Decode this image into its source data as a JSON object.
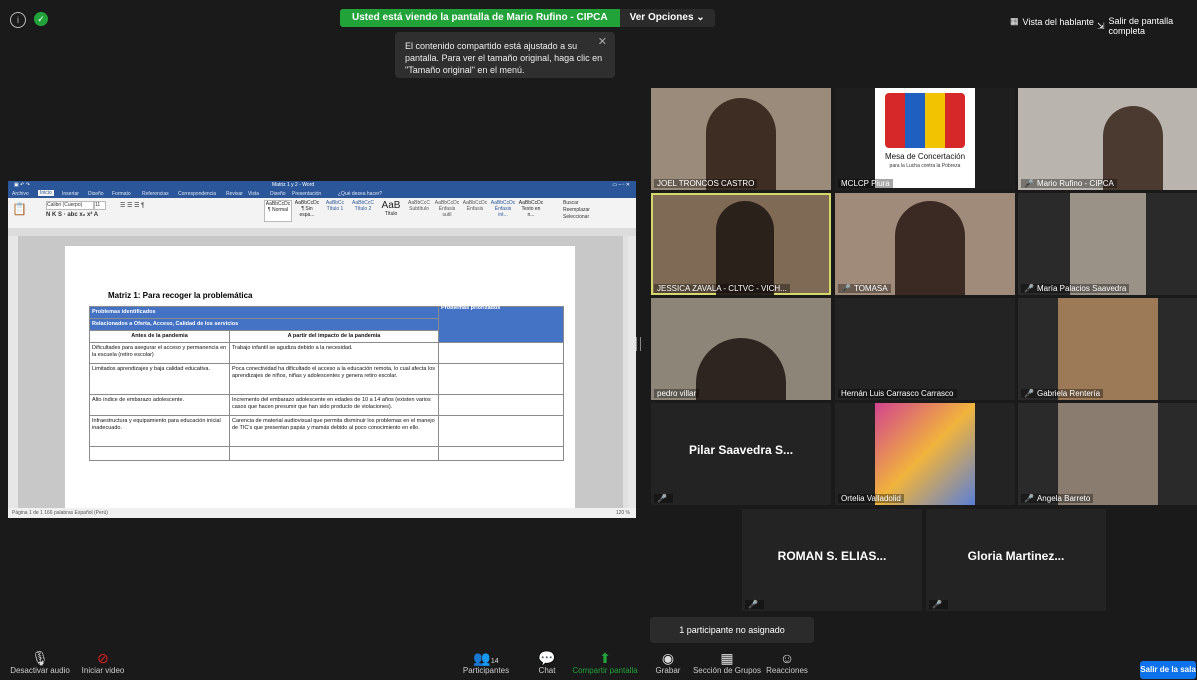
{
  "banner": {
    "viewing": "Usted está viendo la pantalla de Mario Rufino - CIPCA",
    "options": "Ver Opciones ⌄"
  },
  "tooltip": {
    "text": "El contenido compartido está ajustado a su pantalla. Para ver el tamaño original, haga clic en \"Tamaño original\" en el menú.",
    "close": "✕"
  },
  "top_right": {
    "speaker_view": "Vista del hablante",
    "exit_fullscreen": "Salir de pantalla completa"
  },
  "word": {
    "title": "Matriz 1 y 2 - Word",
    "tabs": [
      "Archivo",
      "Inicio",
      "Insertar",
      "Diseño",
      "Formato",
      "Referencias",
      "Correspondencia",
      "Revisar",
      "Vista",
      "Diseño",
      "Presentación",
      "¿Qué desea hacer?"
    ],
    "font": "Calibri (Cuerpo)",
    "font_size": "11",
    "styles": [
      "AaBbCcDc",
      "AaBbCcDc",
      "AaBbCc",
      "AaBbCcC",
      "AaB",
      "AaBbCcC",
      "AaBbCcDc",
      "AaBbCcDc",
      "AaBbCcDc",
      "AaBbCcDc"
    ],
    "style_names": [
      "¶ Normal",
      "¶ Sin espa...",
      "Título 1",
      "Título 2",
      "Título",
      "Subtítulo",
      "Énfasis sutil",
      "Énfasis",
      "Énfasis int...",
      "Texto en n..."
    ],
    "edit": [
      "Buscar",
      "Reemplazar",
      "Seleccionar"
    ],
    "status": "Página 1 de 1   166 palabras   Español (Perú)",
    "zoom": "120 %"
  },
  "doc": {
    "heading": "Matriz 1: Para recoger la problemática",
    "h1": "Problemas identificados",
    "h2": "Relacionados a Oferta, Acceso, Calidad de los servicios",
    "h_prior": "Problemas priorizados",
    "col1": "Antes de la pandemia",
    "col2": "A partir del impacto de la pandemia",
    "rows": [
      {
        "a": "Dificultades para asegurar el acceso y permanencia en la escuela (retiro escolar)",
        "b": "Trabajo infantil se agudiza debido a la necesidad."
      },
      {
        "a": "Limitados aprendizajes y baja calidad educativa.",
        "b": "Poca conectividad ha dificultado el acceso a la educación remota, lo cual afecta los aprendizajes de niños, niñas y adolescentes y genera retiro escolar."
      },
      {
        "a": "Alto índice de embarazo adolescente.",
        "b": "Incremento del embarazo adolescente en edades de 10 a 14 años (existen varios casos que hacen presumir que han sido producto de violaciones)."
      },
      {
        "a": "Infraestructura y equipamiento para educación inicial inadecuado.",
        "b": "Carencia de material audiovisual que permita disminuir los problemas en el manejo de TIC's que presentan papás y mamás debido al poco conocimiento en ello."
      },
      {
        "a": "",
        "b": ""
      }
    ]
  },
  "gallery": [
    {
      "label": "JOEL TRONCOS CASTRO",
      "muted": false,
      "bg": "#9a8b7a"
    },
    {
      "label": "MCLCP Piura",
      "muted": false,
      "bg": "#1e1e1e"
    },
    {
      "label": "Mario Rufino - CIPCA",
      "muted": true,
      "bg": "#b9b4ad"
    },
    {
      "label": "JESSICA ZAVALA - CLTVC - VICH...",
      "muted": false,
      "bg": "#7f6a55"
    },
    {
      "label": "TOMASA",
      "muted": true,
      "bg": "#a08a7a"
    },
    {
      "label": "María Palacios Saavedra",
      "muted": true,
      "bg": "#2a2a2a"
    },
    {
      "label": "pedro villar",
      "muted": false,
      "bg": "#8d8577"
    },
    {
      "label": "Hernán Luis Carrasco Carrasco",
      "muted": false,
      "bg": "#232323"
    },
    {
      "label": "Gabriela Rentería",
      "muted": true,
      "bg": "#2a2a2a"
    },
    {
      "label": "",
      "name": "Pilar Saavedra S...",
      "muted": true,
      "bg": "#232323"
    },
    {
      "label": "Ortelia Valladolid",
      "muted": false,
      "bg": "#232323"
    },
    {
      "label": "Angela Barreto",
      "muted": true,
      "bg": "#2a2a2a"
    },
    {
      "label": "",
      "name": "ROMAN S. ELIAS...",
      "muted": true,
      "bg": "#232323"
    },
    {
      "label": "",
      "name": "Gloria Martinez...",
      "muted": true,
      "bg": "#232323"
    }
  ],
  "logo": {
    "line1": "Mesa de Concertación",
    "line2": "para la Lucha contra la Pobreza"
  },
  "unassigned": "1 participante no asignado",
  "toolbar": {
    "mute": "Desactivar audio",
    "video": "Iniciar video",
    "participants": "Participantes",
    "participants_count": "14",
    "chat": "Chat",
    "share": "Compartir pantalla",
    "record": "Grabar",
    "rooms": "Sección de Grupos",
    "reactions": "Reacciones",
    "leave": "Salir de la sala"
  },
  "colors": {
    "accent": "#0e72ed",
    "share_green": "#22a33a",
    "word_blue": "#2b579a",
    "table_header": "#4472c4",
    "muted_red": "#e02020",
    "speaker_border": "#d6d86b"
  }
}
